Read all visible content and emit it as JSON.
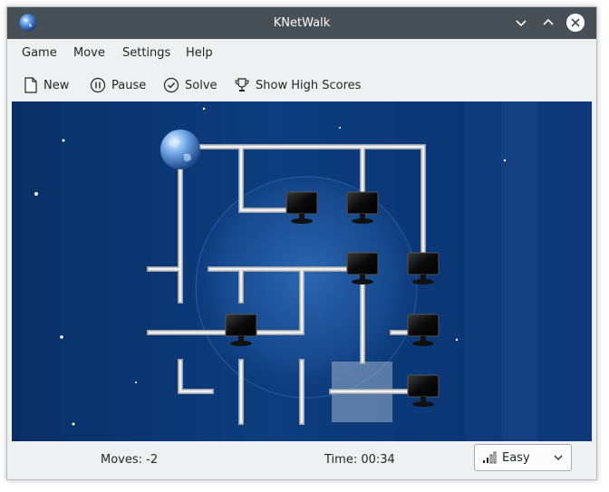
{
  "window": {
    "title": "KNetWalk"
  },
  "menu": {
    "items": [
      "Game",
      "Move",
      "Settings",
      "Help"
    ]
  },
  "toolbar": {
    "new_label": "New",
    "pause_label": "Pause",
    "solve_label": "Solve",
    "highscores_label": "Show High Scores"
  },
  "status": {
    "moves": "Moves: -2",
    "time": "Time: 00:34",
    "difficulty": "Easy"
  },
  "colors": {
    "titlebar": "#475057",
    "board_bg": "#0b3a78",
    "pipe": "#d8dadc",
    "highlight": "#8ea3c0"
  },
  "icons": {
    "app": "earth-icon",
    "minimize": "chevron-down-icon",
    "maximize": "chevron-up-icon",
    "close": "close-icon",
    "new": "new-document-icon",
    "pause": "pause-icon",
    "solve": "check-circle-icon",
    "highscores": "trophy-icon",
    "difficulty": "signal-bars-icon",
    "dropdown": "chevron-down-icon"
  }
}
